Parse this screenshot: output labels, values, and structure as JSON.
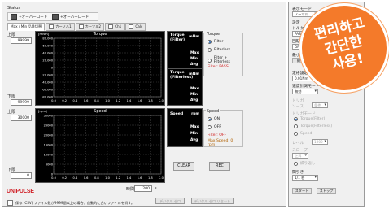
{
  "status": {
    "title": "Status",
    "overload_1": "+オーバーロード",
    "overload_2": "+オーバーロード"
  },
  "tabs": [
    {
      "label": "Max / Min 品番切替"
    },
    {
      "label": "カーソル1"
    },
    {
      "label": "カーソル2"
    },
    {
      "label": "Ch1"
    },
    {
      "label": "Calc"
    }
  ],
  "torque_plot": {
    "title": "Torque",
    "unit": "[mNm]",
    "upper_label": "上限",
    "upper_value": "99999",
    "lower_label": "下限",
    "lower_value": "-99999",
    "y_ticks": [
      "80.000",
      "60.000",
      "40.000",
      "20.000",
      "0",
      "-20.000",
      "-40.000",
      "-60.000",
      "-80.000"
    ],
    "x_ticks": [
      "0.0",
      "0.2",
      "0.4",
      "0.6",
      "0.8",
      "1.0",
      "1.2",
      "1.4",
      "1.6",
      "1.8",
      "2.0"
    ]
  },
  "speed_plot": {
    "title": "Speed",
    "unit": "[rpm]",
    "upper_label": "上限",
    "upper_value": "30000",
    "lower_label": "下限",
    "lower_value": "0",
    "y_ticks": [
      "30000",
      "25000",
      "20000",
      "15000",
      "10000",
      "5000",
      "0"
    ],
    "x_ticks": [
      "0.0",
      "0.2",
      "0.4",
      "0.6",
      "0.8",
      "1.0",
      "1.2",
      "1.4",
      "1.6",
      "1.8",
      "2.0"
    ]
  },
  "torque_stat_1": {
    "title": "Torque",
    "subtitle": "(Filter)",
    "unit": "mNm",
    "rows": [
      "Max",
      "Min",
      "Avg"
    ]
  },
  "torque_stat_2": {
    "title": "Torque",
    "subtitle": "(Filterless)",
    "unit": "mNm",
    "rows": [
      "Max",
      "Min",
      "Avg"
    ]
  },
  "speed_stat": {
    "title": "Speed",
    "unit": "rpm",
    "rows": [
      "Max",
      "Min",
      "Avg"
    ]
  },
  "torque_group": {
    "title": "Torque",
    "options": [
      "Filter",
      "Filterless",
      "Filter + Filterless"
    ],
    "selected": 0,
    "status": "Filter: PASS"
  },
  "speed_group": {
    "title": "Speed",
    "options": [
      "ON",
      "OFF"
    ],
    "selected": 0,
    "filter_status": "Filter: OFF",
    "max_speed": "Max Speed: 0 rpm"
  },
  "buttons": {
    "clear": "CLEAR",
    "rec": "REC"
  },
  "time": {
    "label": "時間",
    "value": "200",
    "unit": "s"
  },
  "footer": {
    "csv_note": "保存 (CSV) ファイル数が9999個以上の場合、自動的に古いファイルを消す。",
    "btn_1": "デジタル ゼロ",
    "btn_2": "デジタル ゼロ リセット"
  },
  "logo": "UNIPULSE",
  "sidebar": {
    "display_mode_label": "表示モード",
    "display_mode_value": "ノーマル",
    "setting_label": "設定",
    "filter_label": "トルクフィルタ",
    "filter_value": "PASS",
    "rotation_label": "回転計検出フィルタ",
    "rotation_value": "OFF",
    "save_label": "最小回転計検出",
    "btn_a": "開始",
    "btn_b": "停止",
    "fixed_label": "定格設定",
    "fixed_value": "0.01Nm",
    "speed_range_label": "速度計測モード",
    "speed_range_value": "無効",
    "trigger_label": "トリガ",
    "trigger_src_label": "ソース",
    "trigger_src_value": "条件",
    "trigger_level_label": "トリガモード",
    "radio_1": "Torque(Filter)",
    "radio_2": "Torque(Filterless)",
    "radio_3": "Speed",
    "level_label": "レベル",
    "level_value": "1000",
    "slope_label": "スロープ",
    "slope_value": "上昇",
    "pretrig_label": "繰り返し",
    "interval_label": "間引き",
    "interval_value": "1/1 秒",
    "start_btn": "スタート",
    "stop_btn": "ストップ"
  },
  "promo": {
    "line1": "편리하고",
    "line2": "간단한",
    "line3": "사용!",
    "color": "#f47a2a"
  }
}
